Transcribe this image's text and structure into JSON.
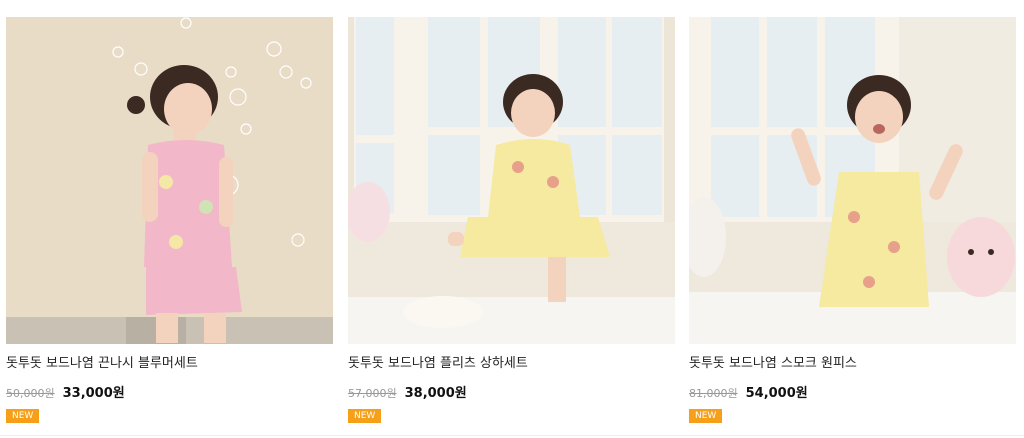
{
  "products": [
    {
      "name": "돗투돗 보드나염 끈나시 블루머세트",
      "original_price": "50,000원",
      "sale_price": "33,000원",
      "badge": "NEW",
      "image": "product-photo"
    },
    {
      "name": "돗투돗 보드나염 플리츠 상하세트",
      "original_price": "57,000원",
      "sale_price": "38,000원",
      "badge": "NEW",
      "image": "product-photo"
    },
    {
      "name": "돗투돗 보드나염 스모크 원피스",
      "original_price": "81,000원",
      "sale_price": "54,000원",
      "badge": "NEW",
      "image": "product-photo"
    }
  ],
  "colors": {
    "badge": "#f6a019",
    "text": "#222222",
    "strike": "#999999"
  }
}
